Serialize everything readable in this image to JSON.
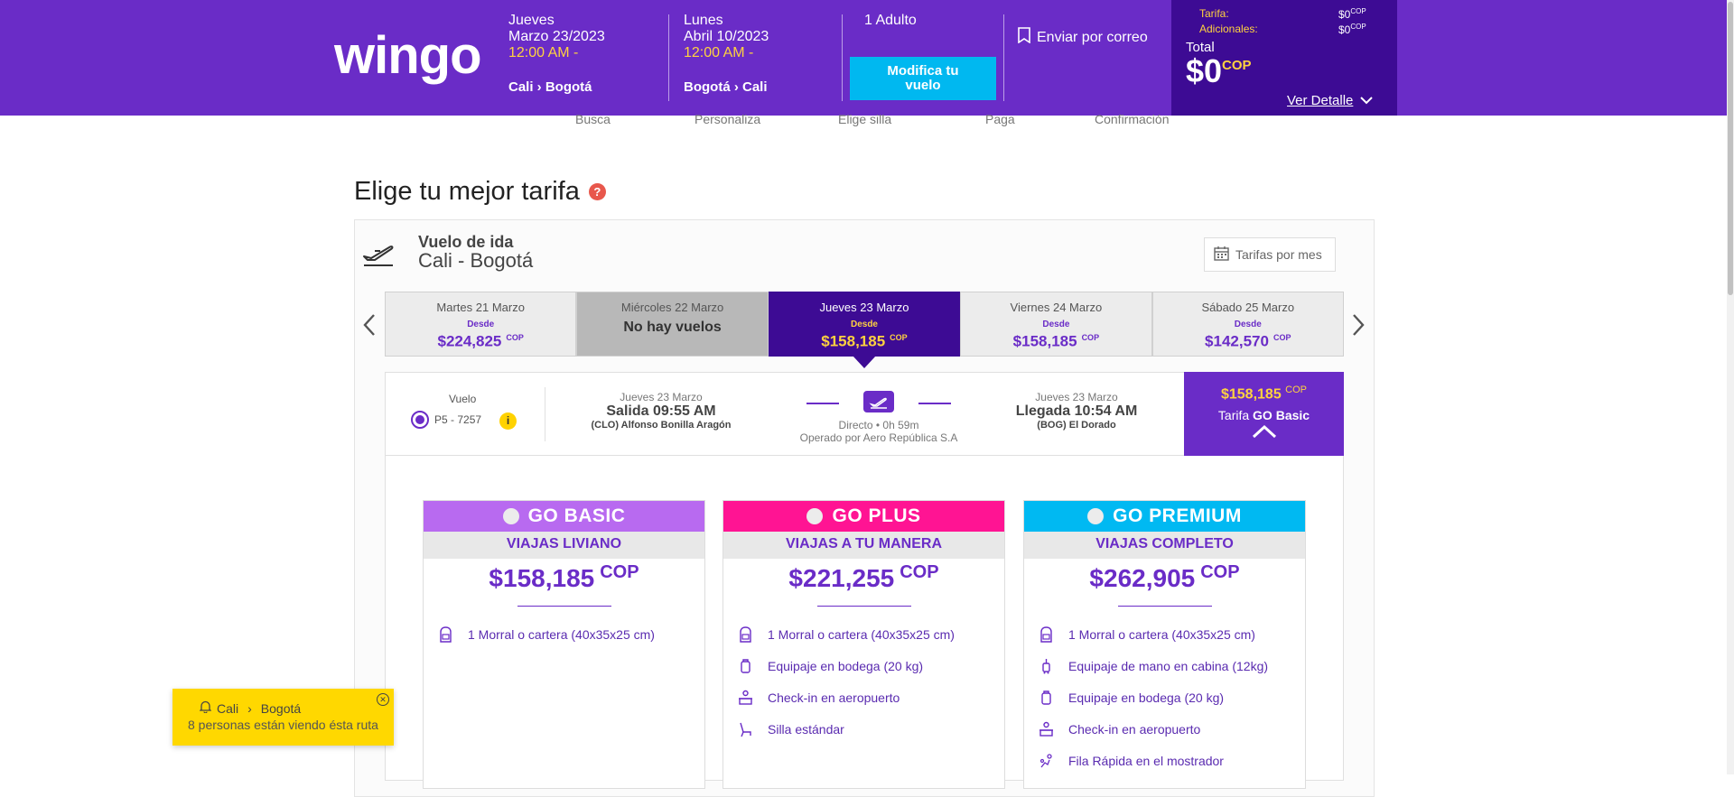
{
  "brand": {
    "logo_text": "wingo",
    "purple": "#6a2cc7",
    "dark_purple": "#3d0b94",
    "yellow": "#ffd23f",
    "cyan": "#00b8f0"
  },
  "header": {
    "outbound": {
      "weekday": "Jueves",
      "date": "Marzo 23/2023",
      "time": "12:00 AM -",
      "route": "Cali › Bogotá"
    },
    "inbound": {
      "weekday": "Lunes",
      "date": "Abril 10/2023",
      "time": "12:00 AM -",
      "route": "Bogotá › Cali"
    },
    "passengers": "1 Adulto",
    "modify_label": "Modifica tu vuelo",
    "email_label": "Enviar por correo",
    "summary": {
      "fare_label": "Tarifa:",
      "fare_value": "$0",
      "fare_currency": "COP",
      "extras_label": "Adicionales:",
      "extras_value": "$0",
      "extras_currency": "COP",
      "total_label": "Total",
      "total_value": "$0",
      "total_currency": "COP",
      "detail_label": "Ver Detalle"
    }
  },
  "steps": [
    "Busca",
    "Personaliza",
    "Elige silla",
    "Paga",
    "Confirmación"
  ],
  "page_title": "Elige tu mejor tarifa",
  "flight": {
    "title": "Vuelo de ida",
    "route": "Cali - Bogotá",
    "month_button": "Tarifas por mes",
    "dates": [
      {
        "day": "Martes 21 Marzo",
        "from": "Desde",
        "price": "$224,825",
        "currency": "COP",
        "state": "normal"
      },
      {
        "day": "Miércoles 22 Marzo",
        "empty": "No hay vuelos",
        "state": "none"
      },
      {
        "day": "Jueves 23 Marzo",
        "from": "Desde",
        "price": "$158,185",
        "currency": "COP",
        "state": "active"
      },
      {
        "day": "Viernes 24 Marzo",
        "from": "Desde",
        "price": "$158,185",
        "currency": "COP",
        "state": "normal"
      },
      {
        "day": "Sábado 25 Marzo",
        "from": "Desde",
        "price": "$142,570",
        "currency": "COP",
        "state": "normal"
      }
    ],
    "row": {
      "label": "Vuelo",
      "number": "P5 - 7257",
      "info": "i",
      "departure": {
        "date": "Jueves 23 Marzo",
        "time": "Salida 09:55 AM",
        "airport": "(CLO) Alfonso Bonilla Aragón"
      },
      "arrival": {
        "date": "Jueves 23 Marzo",
        "time": "Llegada 10:54 AM",
        "airport": "(BOG) El Dorado"
      },
      "direct": "Directo • 0h 59m",
      "operator": "Operado por Aero República S.A",
      "selected_price": "$158,185",
      "selected_currency": "COP",
      "selected_prefix": "Tarifa",
      "selected_name": "GO Basic"
    }
  },
  "fares": [
    {
      "name": "GO BASIC",
      "color": "#b86af0",
      "subtitle": "VIAJAS LIVIANO",
      "price": "$158,185",
      "currency": "COP",
      "features": [
        {
          "icon": "backpack-icon",
          "text": "1 Morral o cartera (40x35x25 cm)"
        }
      ]
    },
    {
      "name": "GO PLUS",
      "color": "#ff1493",
      "subtitle": "VIAJAS A TU MANERA",
      "price": "$221,255",
      "currency": "COP",
      "features": [
        {
          "icon": "backpack-icon",
          "text": "1 Morral o cartera (40x35x25 cm)"
        },
        {
          "icon": "suitcase-icon",
          "text": "Equipaje en bodega (20 kg)"
        },
        {
          "icon": "checkin-icon",
          "text": "Check-in en aeropuerto"
        },
        {
          "icon": "seat-icon",
          "text": "Silla estándar"
        }
      ]
    },
    {
      "name": "GO PREMIUM",
      "color": "#00b9f2",
      "subtitle": "VIAJAS COMPLETO",
      "price": "$262,905",
      "currency": "COP",
      "features": [
        {
          "icon": "backpack-icon",
          "text": "1 Morral o cartera (40x35x25 cm)"
        },
        {
          "icon": "carry-on-icon",
          "text": "Equipaje de mano en cabina (12kg)"
        },
        {
          "icon": "suitcase-icon",
          "text": "Equipaje en bodega (20 kg)"
        },
        {
          "icon": "checkin-icon",
          "text": "Check-in en aeropuerto"
        },
        {
          "icon": "fast-lane-icon",
          "text": "Fila Rápida en el mostrador"
        }
      ]
    }
  ],
  "notification": {
    "origin": "Cali",
    "separator": "›",
    "destination": "Bogotá",
    "message": "8 personas están viendo ésta ruta"
  }
}
